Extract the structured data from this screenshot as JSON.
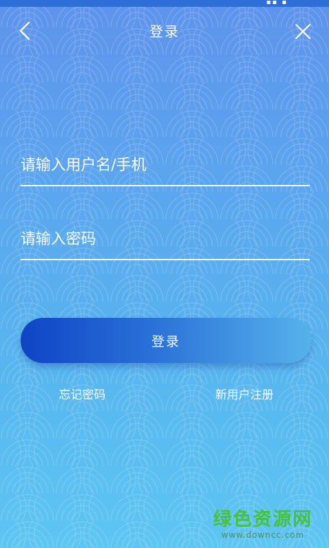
{
  "header": {
    "title": "登录",
    "back_icon": "chevron-left-icon",
    "close_icon": "close-icon"
  },
  "form": {
    "username_placeholder": "请输入用户名/手机",
    "password_placeholder": "请输入密码",
    "username_value": "",
    "password_value": "",
    "login_label": "登录"
  },
  "links": {
    "forgot": "忘记密码",
    "register": "新用户注册"
  },
  "watermark": {
    "name": "绿色资源网",
    "url": "www.downcc.com"
  },
  "colors": {
    "background_top": "#5f93ec",
    "background_bottom": "#5ec6f2",
    "button_start": "#0f44c6",
    "button_end": "#56b2ea",
    "watermark_green": "#48c23b"
  }
}
